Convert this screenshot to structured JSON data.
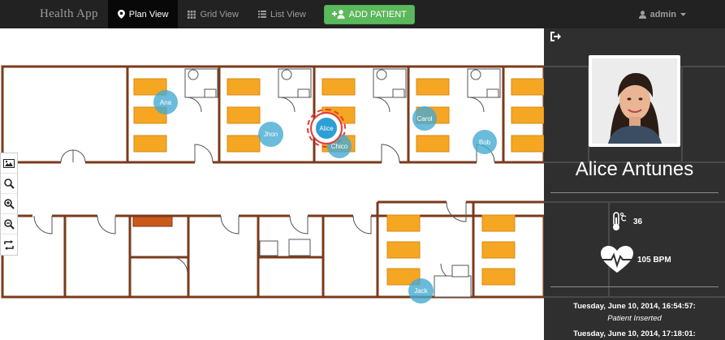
{
  "navbar": {
    "brand": "Health App",
    "tabs": [
      {
        "label": "Plan View",
        "icon": "map-marker-icon",
        "active": true
      },
      {
        "label": "Grid View",
        "icon": "grid-icon",
        "active": false
      },
      {
        "label": "List View",
        "icon": "list-icon",
        "active": false
      }
    ],
    "add_patient_label": "ADD PATIENT",
    "user": "admin"
  },
  "plan": {
    "tools": [
      "image-icon",
      "search-icon",
      "zoom-in-icon",
      "zoom-out-icon",
      "rotate-icon"
    ],
    "patients": [
      {
        "name": "Ana",
        "selected": false
      },
      {
        "name": "Jhon",
        "selected": false
      },
      {
        "name": "Alice",
        "selected": true
      },
      {
        "name": "Chico",
        "selected": false
      },
      {
        "name": "Carol",
        "selected": false
      },
      {
        "name": "Bob",
        "selected": false
      },
      {
        "name": "Jack",
        "selected": false
      }
    ]
  },
  "side": {
    "patient_name": "Alice Antunes",
    "temperature": "36",
    "bpm": "105 BPM",
    "events": [
      {
        "time": "Tuesday, June 10, 2014, 16:54:57:",
        "message": "Patient Inserted"
      },
      {
        "time": "Tuesday, June 10, 2014, 17:18:01:",
        "message": ""
      }
    ]
  },
  "colors": {
    "accent_green": "#5cb85c",
    "marker_blue": "#46aad2",
    "selected_ring": "#e53935",
    "navbar": "#222222",
    "bed": "#f5a623"
  }
}
